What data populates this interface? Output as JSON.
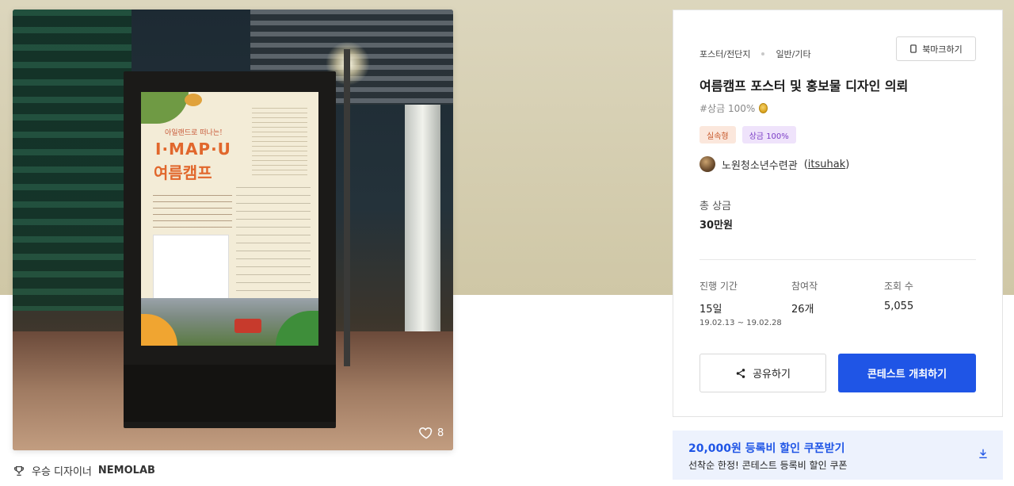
{
  "hero": {
    "poster_lines": {
      "kicker": "아일랜드로 떠나는!",
      "line1": "I·MAP·U",
      "line2": "여름캠프"
    },
    "likes_count": "8",
    "icons": [
      "heart-icon"
    ]
  },
  "award": {
    "prefix": "우승 디자이너",
    "name": "NEMOLAB",
    "icon": "trophy-icon"
  },
  "card": {
    "bookmark_label": "북마크하기",
    "category": "포스터/전단지",
    "subcategory": "일반/기타",
    "title": "여름캠프 포스터 및 홍보물 디자인 의뢰",
    "prize_tag": "#상금 100%",
    "badges": [
      "실속형",
      "상금 100%"
    ],
    "host_name": "노원청소년수련관",
    "host_id": "itsuhak",
    "total_prize_label": "총 상금",
    "total_prize_value": "30만원",
    "stats": [
      {
        "label": "진행 기간",
        "value": "15일",
        "sub": "19.02.13 ~ 19.02.28"
      },
      {
        "label": "참여작",
        "value": "26개",
        "sub": ""
      },
      {
        "label": "조회 수",
        "value": "5,055",
        "sub": ""
      }
    ],
    "share_label": "공유하기",
    "host_contest_label": "콘테스트 개최하기"
  },
  "coupon": {
    "title": "20,000원 등록비 할인 쿠폰받기",
    "subtitle": "선착순 한정! 콘테스트 등록비 할인 쿠폰"
  },
  "colors": {
    "accent": "#1f55e6",
    "badge_orange_bg": "#fbe7dc",
    "badge_orange_text": "#c7592b",
    "badge_purple_bg": "#efe3fb",
    "badge_purple_text": "#7b3dc6",
    "coupon_bg": "#edf2fd",
    "band_bg": "#d6cfb2"
  }
}
